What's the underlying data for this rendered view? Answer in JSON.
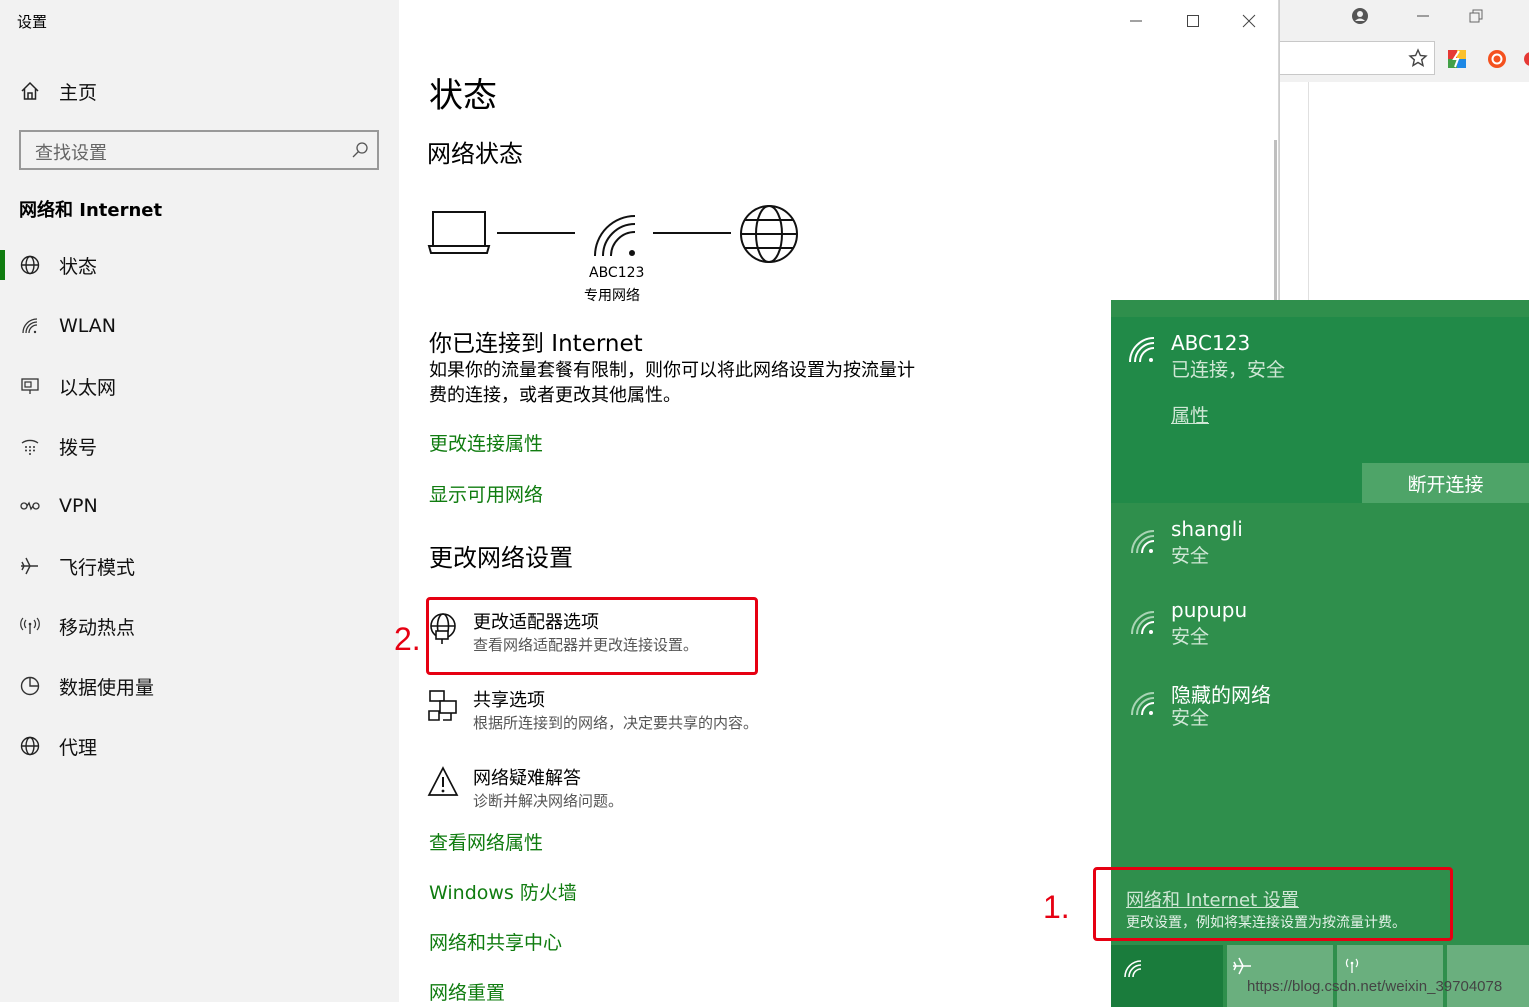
{
  "window_title": "设置",
  "window_controls": [
    "minimize",
    "maximize",
    "close"
  ],
  "sidebar": {
    "home_label": "主页",
    "search_placeholder": "查找设置",
    "section_title": "网络和 Internet",
    "items": [
      {
        "label": "状态",
        "icon": "globe-icon",
        "selected": true
      },
      {
        "label": "WLAN",
        "icon": "wifi-icon"
      },
      {
        "label": "以太网",
        "icon": "ethernet-icon"
      },
      {
        "label": "拨号",
        "icon": "dialup-icon"
      },
      {
        "label": "VPN",
        "icon": "vpn-icon"
      },
      {
        "label": "飞行模式",
        "icon": "airplane-icon"
      },
      {
        "label": "移动热点",
        "icon": "hotspot-icon"
      },
      {
        "label": "数据使用量",
        "icon": "data-usage-icon"
      },
      {
        "label": "代理",
        "icon": "globe-icon"
      }
    ]
  },
  "main": {
    "title": "状态",
    "network_status_heading": "网络状态",
    "diagram": {
      "network_name": "ABC123",
      "network_type": "专用网络"
    },
    "connected_heading": "你已连接到 Internet",
    "connected_desc_line1": "如果你的流量套餐有限制，则你可以将此网络设置为按流量计",
    "connected_desc_line2": "费的连接，或者更改其他属性。",
    "link_change_props": "更改连接属性",
    "link_show_networks": "显示可用网络",
    "change_settings_heading": "更改网络设置",
    "options": [
      {
        "title": "更改适配器选项",
        "desc": "查看网络适配器并更改连接设置。",
        "icon": "adapter-globe-icon"
      },
      {
        "title": "共享选项",
        "desc": "根据所连接到的网络，决定要共享的内容。",
        "icon": "sharing-icon"
      },
      {
        "title": "网络疑难解答",
        "desc": "诊断并解决网络问题。",
        "icon": "warning-icon"
      }
    ],
    "links": [
      "查看网络属性",
      "Windows 防火墙",
      "网络和共享中心",
      "网络重置"
    ]
  },
  "flyout": {
    "connected": {
      "name": "ABC123",
      "status": "已连接，安全",
      "properties_link": "属性",
      "disconnect_button": "断开连接"
    },
    "networks": [
      {
        "name": "shangli",
        "status": "安全"
      },
      {
        "name": "pupupu",
        "status": "安全"
      },
      {
        "name": "隐藏的网络",
        "status": "安全"
      }
    ],
    "settings_link": "网络和 Internet 设置",
    "settings_desc": "更改设置，例如将某连接设置为按流量计费。"
  },
  "annotations": {
    "step1": "1.",
    "step2": "2."
  },
  "watermark": "https://blog.csdn.net/weixin_39704078",
  "colors": {
    "accent": "#107c10",
    "flyout_bg": "#2f8f4c",
    "annotation_red": "#e60012"
  }
}
